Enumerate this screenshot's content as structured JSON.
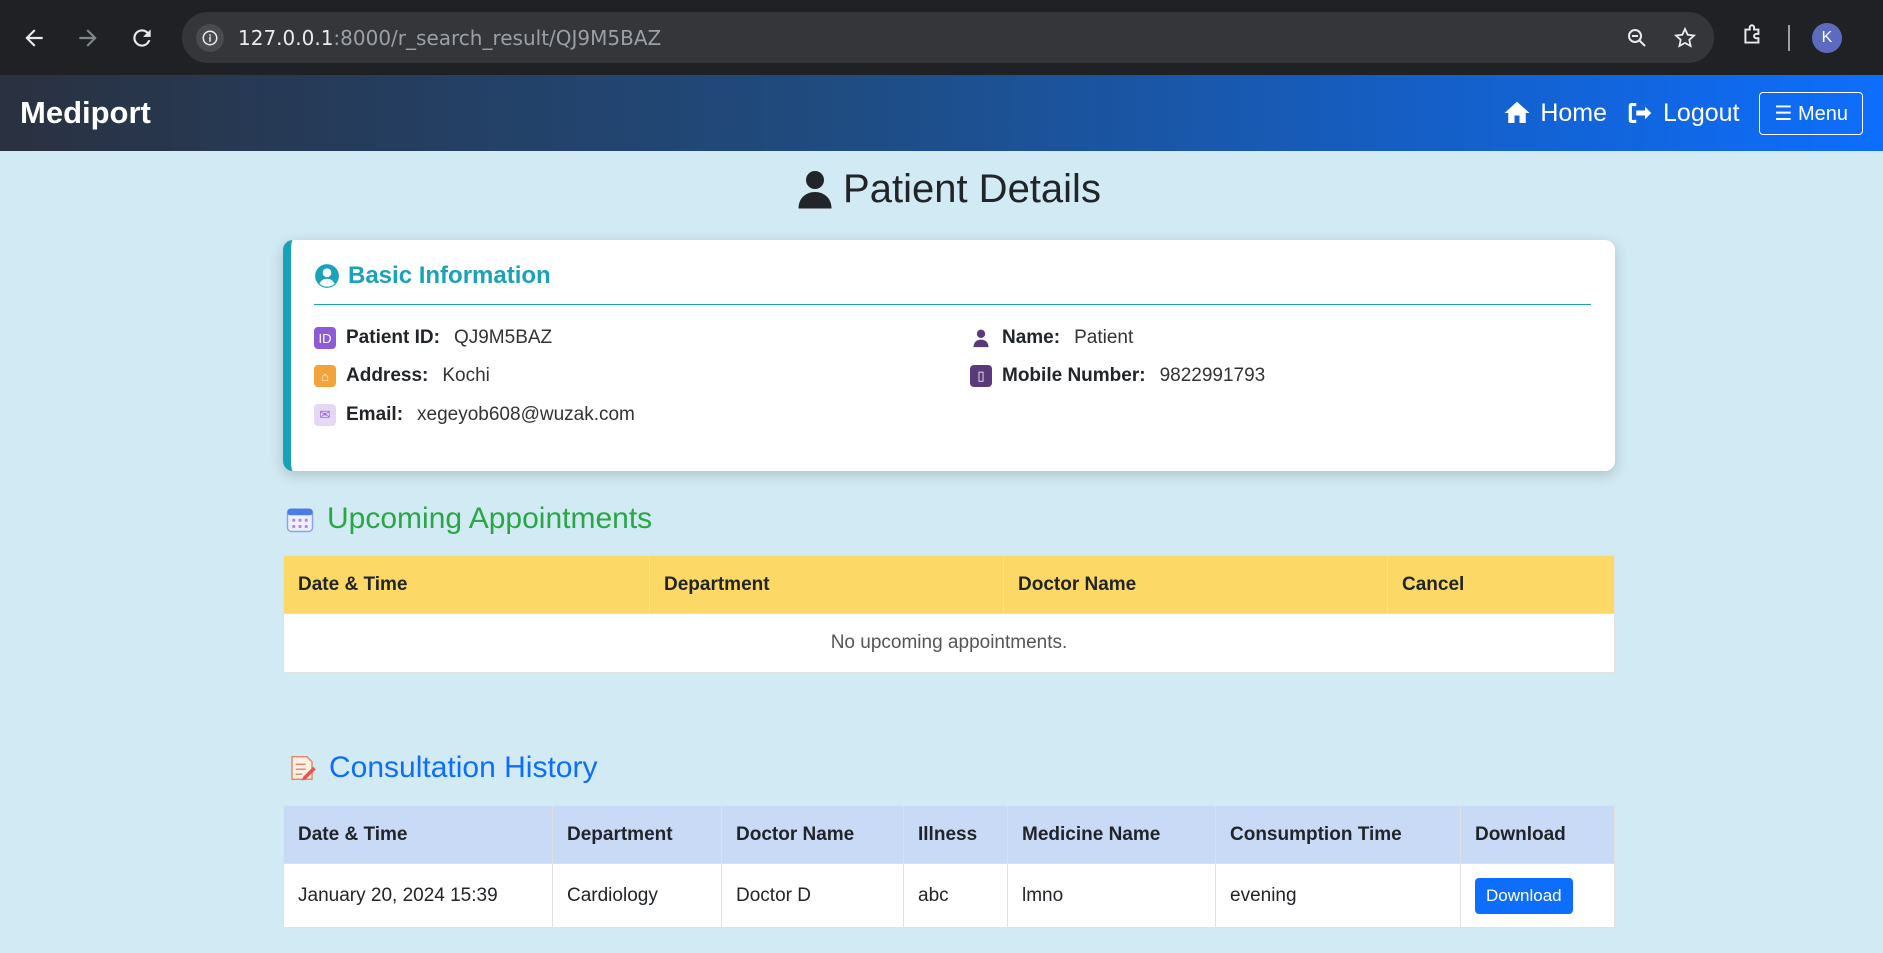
{
  "browser": {
    "url_host": "127.0.0.1",
    "url_path": ":8000/r_search_result/QJ9M5BAZ",
    "profile_initial": "K"
  },
  "navbar": {
    "brand": "Mediport",
    "home_label": "Home",
    "logout_label": "Logout",
    "menu_label": "☰ Menu"
  },
  "page": {
    "title": "Patient Details"
  },
  "basic_info": {
    "heading": "Basic Information",
    "patient_id_label": "Patient ID:",
    "patient_id": "QJ9M5BAZ",
    "name_label": "Name:",
    "name": "Patient",
    "address_label": "Address:",
    "address": "Kochi",
    "mobile_label": "Mobile Number:",
    "mobile": "9822991793",
    "email_label": "Email:",
    "email": "xegeyob608@wuzak.com"
  },
  "upcoming": {
    "heading": "Upcoming Appointments",
    "columns": [
      "Date & Time",
      "Department",
      "Doctor Name",
      "Cancel"
    ],
    "empty_text": "No upcoming appointments."
  },
  "history": {
    "heading": "Consultation History",
    "columns": [
      "Date & Time",
      "Department",
      "Doctor Name",
      "Illness",
      "Medicine Name",
      "Consumption Time",
      "Download"
    ],
    "rows": [
      {
        "date_time": "January 20, 2024 15:39",
        "department": "Cardiology",
        "doctor": "Doctor D",
        "illness": "abc",
        "medicine": "lmno",
        "consumption": "evening",
        "download_label": "Download"
      }
    ]
  },
  "colors": {
    "navbar_start": "#2a3140",
    "navbar_end": "#0d6efd",
    "page_bg": "#d2eaf3",
    "basic_info_accent": "#17a2b8",
    "upcoming_title": "#28a745",
    "upcoming_header": "#fcd866",
    "history_title": "#0d6efd",
    "history_header": "#c9daf6",
    "button_primary": "#0d6efd"
  }
}
